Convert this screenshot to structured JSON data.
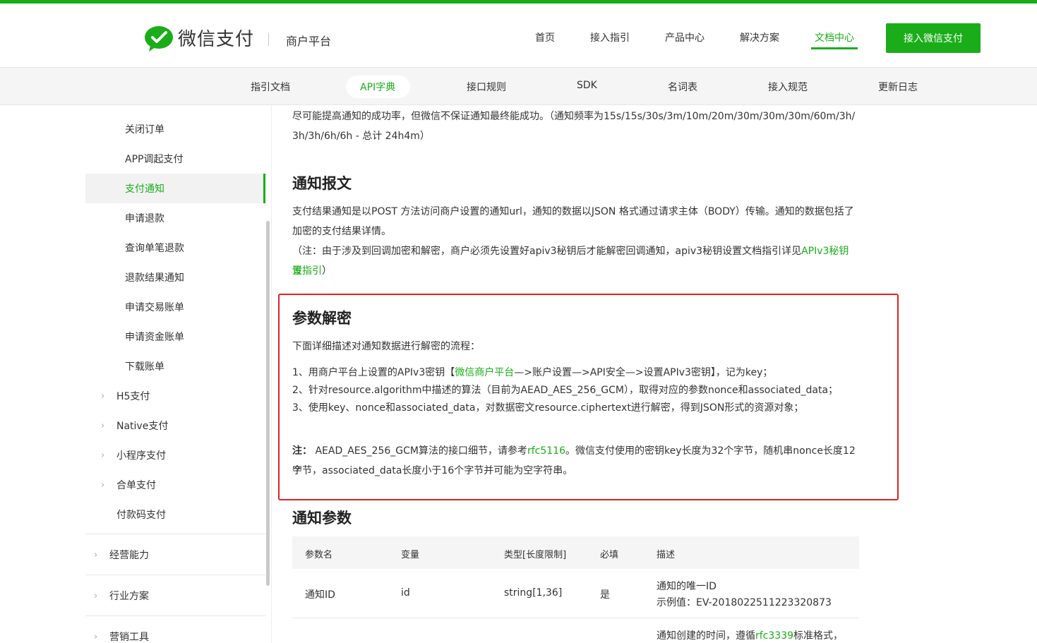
{
  "header": {
    "brand": "微信支付",
    "platform": "商户平台",
    "nav": [
      "首页",
      "接入指引",
      "产品中心",
      "解决方案",
      "文档中心"
    ],
    "active_nav": "文档中心",
    "cta_label": "接入微信支付",
    "accent": "#1aad19"
  },
  "subnav": {
    "items": [
      "指引文档",
      "API字典",
      "接口规则",
      "SDK",
      "名词表",
      "接入规范",
      "更新日志"
    ],
    "active": "API字典"
  },
  "sidebar": {
    "items": [
      "关闭订单",
      "APP调起支付",
      "支付通知",
      "申请退款",
      "查询单笔退款",
      "退款结果通知",
      "申请交易账单",
      "申请资金账单",
      "下载账单"
    ],
    "active": "支付通知",
    "groups": [
      "H5支付",
      "Native支付",
      "小程序支付",
      "合单支付",
      "付款码支付"
    ],
    "sections": [
      "经营能力",
      "行业方案",
      "营销工具"
    ]
  },
  "content": {
    "intro_line1": "尽可能提高通知的成功率，但微信不保证通知最终能成功。（通知频率为15s/15s/30s/3m/10m/20m/30m/30m/30m/60m/3h/",
    "intro_line2": "3h/3h/6h/6h - 总计 24h4m）",
    "section1_title": "通知报文",
    "section1_p1_line1": "支付结果通知是以POST 方法访问商户设置的通知url，通知的数据以JSON 格式通过请求主体（BODY）传输。通知的数据包括了",
    "section1_p1_line2": "加密的支付结果详情。",
    "section1_note_line1": "（注：由于涉及到回调加密和解密，商户必须先设置好apiv3秘钥后才能解密回调通知，apiv3秘钥设置文档指引详见",
    "section1_note_link1": "APIv3秘钥设",
    "section1_note_link2": "置指引",
    "section1_note_end": "）",
    "section2_title": "参数解密",
    "section2_lead": "下面详细描述对通知数据进行解密的流程：",
    "step1_pre": "1、用商户平台上设置的APIv3密钥【",
    "step1_link": "微信商户平台",
    "step1_post": "—>账户设置—>API安全—>设置APIv3密钥】，记为key；",
    "step2": "2、针对resource.algorithm中描述的算法（目前为AEAD_AES_256_GCM），取得对应的参数nonce和associated_data；",
    "step3": "3、使用key、nonce和associated_data，对数据密文resource.ciphertext进行解密，得到JSON形式的资源对象；",
    "note_label": "注：",
    "note_pre": " AEAD_AES_256_GCM算法的接口细节，请参考",
    "note_link": "rfc5116",
    "note_post": "。微信支付使用的密钥key长度为32个字节，随机串nonce长度12个",
    "note_line2": "字节，associated_data长度小于16个字节并可能为空字符串。",
    "section3_title": "通知参数"
  },
  "table": {
    "headers": [
      "参数名",
      "变量",
      "类型[长度限制]",
      "必填",
      "描述"
    ],
    "rows": [
      {
        "name": "通知ID",
        "var": "id",
        "type": "string[1,36]",
        "required": "是",
        "desc": "通知的唯一ID",
        "example": "示例值：EV-2018022511223320873"
      },
      {
        "desc_pre": "通知创建的时间，遵循",
        "desc_link": "rfc3339",
        "desc_post": "标准格式，"
      }
    ]
  }
}
